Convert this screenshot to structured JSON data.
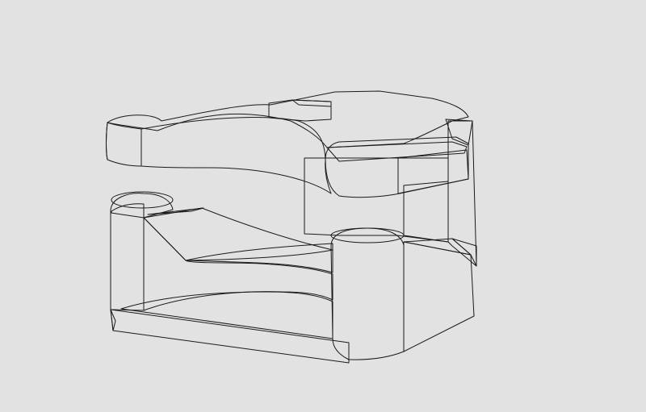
{
  "viewport": {
    "background": "#e2e2e2"
  },
  "model": {
    "colors": {
      "top_dark": "#3a3a3a",
      "face_light": "#d8d8d8",
      "face_mid": "#bcbcbc",
      "face_shade": "#9a9a9a",
      "face_deep": "#7e7e7e",
      "edge": "#1a1a1a"
    }
  }
}
